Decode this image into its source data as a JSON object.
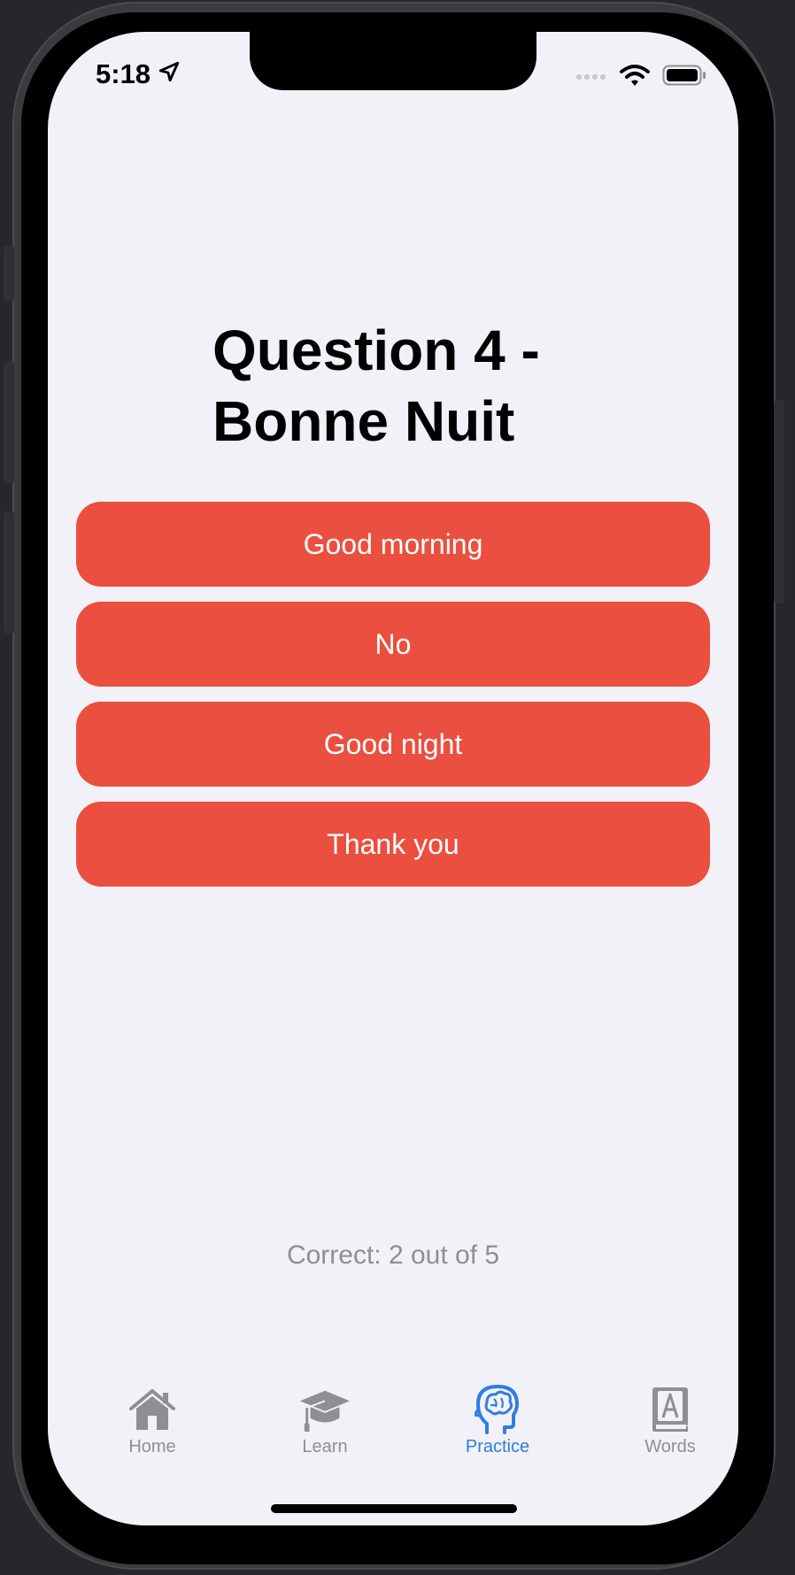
{
  "status_bar": {
    "time": "5:18"
  },
  "question": {
    "title": "Question 4 - Bonne Nuit"
  },
  "answers": [
    {
      "label": "Good morning"
    },
    {
      "label": "No"
    },
    {
      "label": "Good night"
    },
    {
      "label": "Thank you"
    }
  ],
  "score": {
    "text": "Correct: 2 out of 5"
  },
  "tab_bar": {
    "tabs": [
      {
        "label": "Home",
        "icon": "house-icon",
        "active": false
      },
      {
        "label": "Learn",
        "icon": "graduation-cap-icon",
        "active": false
      },
      {
        "label": "Practice",
        "icon": "brain-head-icon",
        "active": true
      },
      {
        "label": "Words",
        "icon": "dictionary-book-icon",
        "active": false
      }
    ]
  },
  "colors": {
    "answer_button": "#ea4f3f",
    "tab_active": "#2f7de1",
    "tab_inactive": "#8e8e93",
    "background": "#f2f1f7"
  }
}
